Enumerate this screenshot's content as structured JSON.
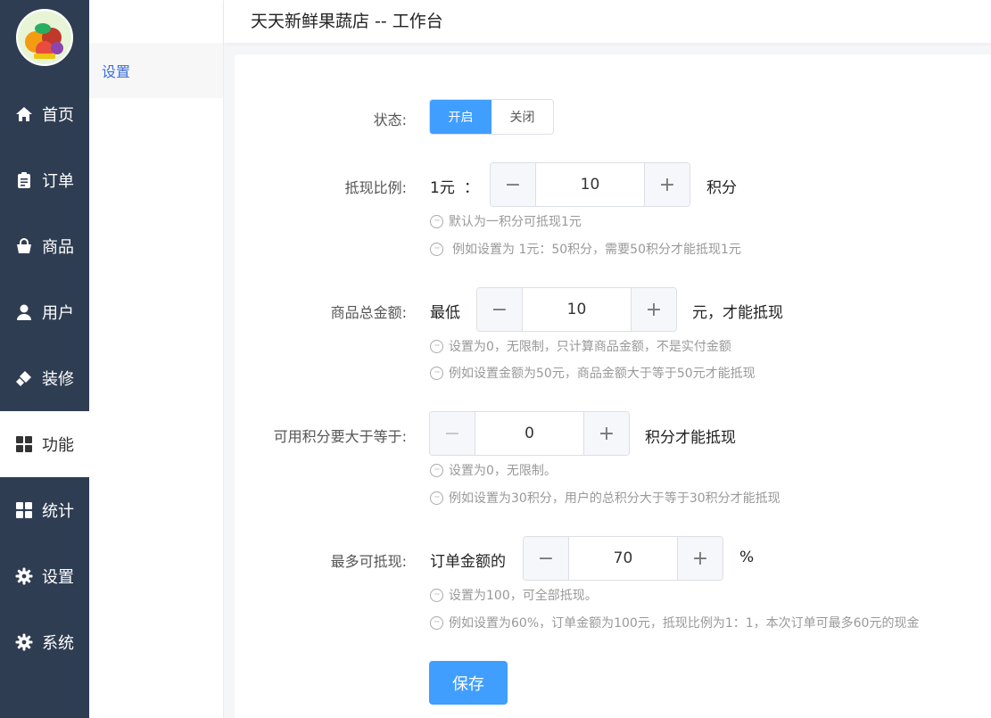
{
  "header": {
    "title": "天天新鲜果蔬店 -- 工作台"
  },
  "nav": {
    "items": [
      {
        "label": "首页",
        "icon": "home-icon"
      },
      {
        "label": "订单",
        "icon": "clipboard-icon"
      },
      {
        "label": "商品",
        "icon": "shopping-bag-icon"
      },
      {
        "label": "用户",
        "icon": "user-icon"
      },
      {
        "label": "装修",
        "icon": "brush-icon"
      },
      {
        "label": "功能",
        "icon": "grid-icon",
        "active": true
      },
      {
        "label": "统计",
        "icon": "grid-icon"
      },
      {
        "label": "设置",
        "icon": "gear-icon"
      },
      {
        "label": "系统",
        "icon": "gear-icon"
      }
    ]
  },
  "subnav": {
    "items": [
      {
        "label": "设置",
        "active": true
      }
    ]
  },
  "form": {
    "status": {
      "label": "状态:",
      "on": "开启",
      "off": "关闭",
      "selected": "开启"
    },
    "ratio": {
      "label": "抵现比例:",
      "prefix": "1元",
      "colon": "：",
      "value": "10",
      "suffix": "积分",
      "hint1": "默认为一积分可抵现1元",
      "hint2": "例如设置为 1元：50积分，需要50积分才能抵现1元"
    },
    "total": {
      "label": "商品总金额:",
      "prefix": "最低",
      "value": "10",
      "suffix": "元，才能抵现",
      "hint1": "设置为0，无限制，只计算商品金额，不是实付金额",
      "hint2": "例如设置金额为50元，商品金额大于等于50元才能抵现"
    },
    "points": {
      "label": "可用积分要大于等于:",
      "value": "0",
      "suffix": "积分才能抵现",
      "hint1": "设置为0，无限制。",
      "hint2": "例如设置为30积分，用户的总积分大于等于30积分才能抵现"
    },
    "max": {
      "label": "最多可抵现:",
      "prefix": "订单金额的",
      "value": "70",
      "suffix": "%",
      "hint1": "设置为100，可全部抵现。",
      "hint2": "例如设置为60%，订单金额为100元，抵现比例为1：1，本次订单可最多60元的现金"
    },
    "save_label": "保存"
  },
  "steppers": {
    "minus_symbol": "−",
    "plus_symbol": "+"
  },
  "colors": {
    "nav_bg": "#2f3d52",
    "primary": "#409eff"
  }
}
